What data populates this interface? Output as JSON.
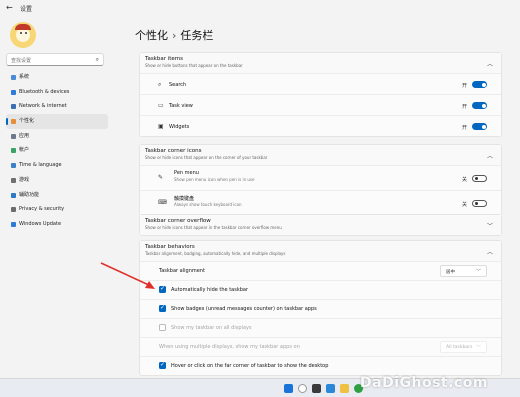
{
  "window": {
    "back_glyph": "←",
    "title": "设置"
  },
  "sidebar": {
    "search_placeholder": "查找设置",
    "items": [
      {
        "label": "系统",
        "icon": "system-icon",
        "color": "#4b8ad6"
      },
      {
        "label": "Bluetooth & devices",
        "icon": "bluetooth-icon",
        "color": "#2f7bd8"
      },
      {
        "label": "Network & internet",
        "icon": "network-icon",
        "color": "#3b6fb5"
      },
      {
        "label": "个性化",
        "icon": "brush-icon",
        "color": "#e58f3b",
        "active": true
      },
      {
        "label": "应用",
        "icon": "apps-icon",
        "color": "#6d7a8a"
      },
      {
        "label": "帐户",
        "icon": "account-icon",
        "color": "#3aa365"
      },
      {
        "label": "Time & language",
        "icon": "clock-icon",
        "color": "#3c80c8"
      },
      {
        "label": "游戏",
        "icon": "gaming-icon",
        "color": "#6f6f6f"
      },
      {
        "label": "辅助功能",
        "icon": "accessibility-icon",
        "color": "#2b79c7"
      },
      {
        "label": "Privacy & security",
        "icon": "shield-icon",
        "color": "#6b6b6b"
      },
      {
        "label": "Windows Update",
        "icon": "update-icon",
        "color": "#2f7bd8"
      }
    ]
  },
  "breadcrumb": {
    "parent": "个性化",
    "separator": "›",
    "current": "任务栏"
  },
  "taskbar_items": {
    "title": "Taskbar items",
    "subtitle": "Show or hide buttons that appear on the taskbar",
    "rows": [
      {
        "label": "Search",
        "icon": "search-icon",
        "icon_glyph": "⌕",
        "state": "开",
        "on": true
      },
      {
        "label": "Task view",
        "icon": "task-view-icon",
        "icon_glyph": "▭",
        "state": "开",
        "on": true
      },
      {
        "label": "Widgets",
        "icon": "widgets-icon",
        "icon_glyph": "▣",
        "state": "开",
        "on": true
      }
    ]
  },
  "corner_icons": {
    "title": "Taskbar corner icons",
    "subtitle": "Show or hide icons that appear on the corner of your taskbar",
    "rows": [
      {
        "label": "Pen menu",
        "sub": "Show pen menu icon when pen is in use",
        "icon": "pen-icon",
        "icon_glyph": "✎",
        "state": "关",
        "on": false
      },
      {
        "label": "触摸键盘",
        "sub": "Always show touch keyboard icon",
        "icon": "keyboard-icon",
        "icon_glyph": "⌨",
        "state": "关",
        "on": false
      }
    ]
  },
  "corner_overflow": {
    "title": "Taskbar corner overflow",
    "subtitle": "Show or hide icons that appear in the taskbar corner overflow menu"
  },
  "behaviors": {
    "title": "Taskbar behaviors",
    "subtitle": "Taskbar alignment, badging, automatically hide, and multiple displays",
    "alignment_label": "Taskbar alignment",
    "alignment_value": "居中",
    "auto_hide": "Automatically hide the taskbar",
    "badges": "Show badges (unread messages counter) on taskbar apps",
    "all_displays": "Show my taskbar on all displays",
    "multi_display": "When using multiple displays, show my taskbar apps on",
    "multi_display_value": "All taskbars",
    "hover_corner": "Hover or click on the far corner of taskbar to show the desktop"
  },
  "watermark": "DaDiGhost.com",
  "accent_color": "#0067c0",
  "annotation_arrow_color": "#e0302a"
}
